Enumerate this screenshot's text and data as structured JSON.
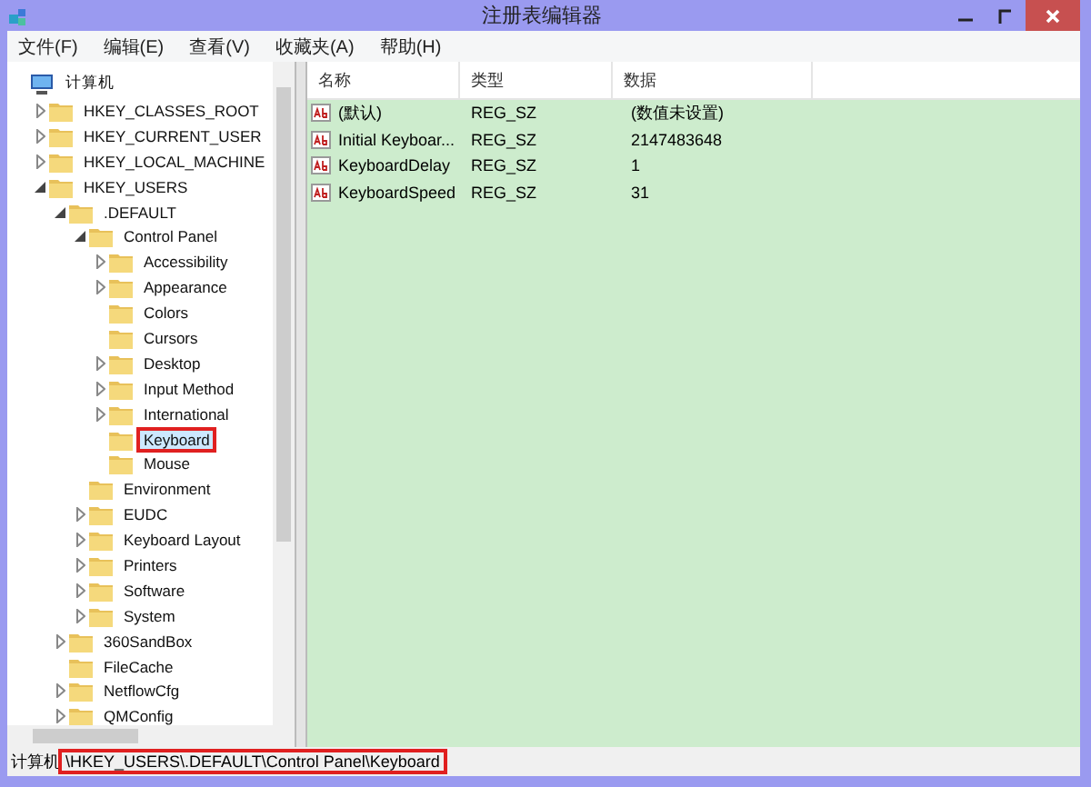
{
  "window": {
    "title": "注册表编辑器"
  },
  "menu": [
    "文件(F)",
    "编辑(E)",
    "查看(V)",
    "收藏夹(A)",
    "帮助(H)"
  ],
  "tree": [
    {
      "label": "计算机",
      "kind": "computer",
      "selected": false,
      "children": [
        {
          "label": "HKEY_CLASSES_ROOT",
          "expanded": false,
          "has_children": true,
          "selected": false
        },
        {
          "label": "HKEY_CURRENT_USER",
          "expanded": false,
          "has_children": true,
          "selected": false
        },
        {
          "label": "HKEY_LOCAL_MACHINE",
          "expanded": false,
          "has_children": true,
          "selected": false
        },
        {
          "label": "HKEY_USERS",
          "expanded": true,
          "has_children": true,
          "selected": false,
          "children": [
            {
              "label": ".DEFAULT",
              "expanded": true,
              "has_children": true,
              "selected": false,
              "children": [
                {
                  "label": "Control Panel",
                  "expanded": true,
                  "has_children": true,
                  "selected": false,
                  "children": [
                    {
                      "label": "Accessibility",
                      "expanded": false,
                      "has_children": true,
                      "selected": false
                    },
                    {
                      "label": "Appearance",
                      "expanded": false,
                      "has_children": true,
                      "selected": false
                    },
                    {
                      "label": "Colors",
                      "expanded": false,
                      "has_children": false,
                      "selected": false
                    },
                    {
                      "label": "Cursors",
                      "expanded": false,
                      "has_children": false,
                      "selected": false
                    },
                    {
                      "label": "Desktop",
                      "expanded": false,
                      "has_children": true,
                      "selected": false
                    },
                    {
                      "label": "Input Method",
                      "expanded": false,
                      "has_children": true,
                      "selected": false
                    },
                    {
                      "label": "International",
                      "expanded": false,
                      "has_children": true,
                      "selected": false
                    },
                    {
                      "label": "Keyboard",
                      "expanded": false,
                      "has_children": false,
                      "selected": true
                    },
                    {
                      "label": "Mouse",
                      "expanded": false,
                      "has_children": false,
                      "selected": false
                    }
                  ]
                },
                {
                  "label": "Environment",
                  "expanded": false,
                  "has_children": false,
                  "selected": false
                },
                {
                  "label": "EUDC",
                  "expanded": false,
                  "has_children": true,
                  "selected": false
                },
                {
                  "label": "Keyboard Layout",
                  "expanded": false,
                  "has_children": true,
                  "selected": false
                },
                {
                  "label": "Printers",
                  "expanded": false,
                  "has_children": true,
                  "selected": false
                },
                {
                  "label": "Software",
                  "expanded": false,
                  "has_children": true,
                  "selected": false
                },
                {
                  "label": "System",
                  "expanded": false,
                  "has_children": true,
                  "selected": false
                }
              ]
            },
            {
              "label": "360SandBox",
              "expanded": false,
              "has_children": true,
              "selected": false
            },
            {
              "label": "FileCache",
              "expanded": false,
              "has_children": false,
              "selected": false
            },
            {
              "label": "NetflowCfg",
              "expanded": false,
              "has_children": true,
              "selected": false
            },
            {
              "label": "QMConfig",
              "expanded": false,
              "has_children": true,
              "selected": false
            }
          ]
        }
      ]
    }
  ],
  "table": {
    "columns": [
      "名称",
      "类型",
      "数据"
    ],
    "rows": [
      [
        "(默认)",
        "REG_SZ",
        "(数值未设置)"
      ],
      [
        "Initial Keyboar...",
        "REG_SZ",
        "2147483648"
      ],
      [
        "KeyboardDelay",
        "REG_SZ",
        "1"
      ],
      [
        "KeyboardSpeed",
        "REG_SZ",
        "31"
      ]
    ]
  },
  "status_bar": {
    "prefix": "计算机",
    "path": "\\HKEY_USERS\\.DEFAULT\\Control Panel\\Keyboard"
  }
}
